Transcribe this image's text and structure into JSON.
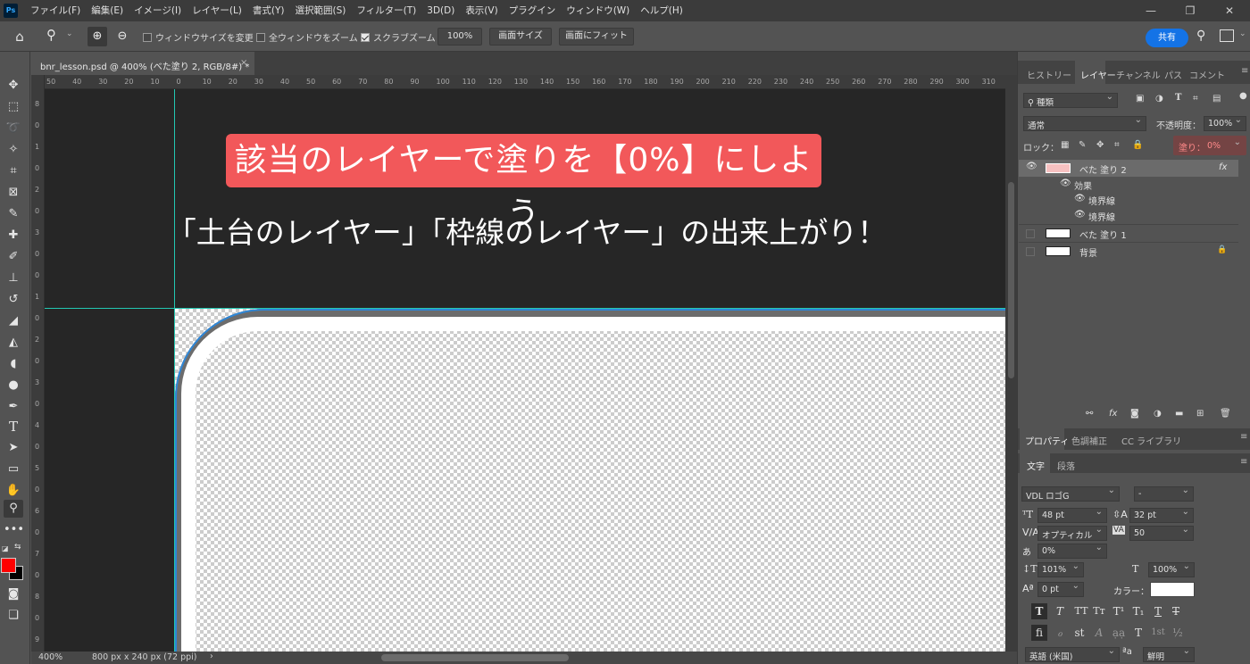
{
  "menubar": {
    "logo": "Ps",
    "items": [
      "ファイル(F)",
      "編集(E)",
      "イメージ(I)",
      "レイヤー(L)",
      "書式(Y)",
      "選択範囲(S)",
      "フィルター(T)",
      "3D(D)",
      "表示(V)",
      "プラグイン",
      "ウィンドウ(W)",
      "ヘルプ(H)"
    ]
  },
  "options": {
    "check1": "ウィンドウサイズを変更",
    "check2": "全ウィンドウをズーム",
    "check3": "スクラブズーム",
    "zoom_value": "100%",
    "fit_screen": "画面サイズ",
    "fill_screen": "画面にフィット",
    "share": "共有"
  },
  "document": {
    "tab_title": "bnr_lesson.psd @ 400% (べた塗り 2, RGB/8#) *",
    "ruler_top": [
      "50",
      "40",
      "30",
      "20",
      "10",
      "0",
      "10",
      "20",
      "30",
      "40",
      "50",
      "60",
      "70",
      "80",
      "90",
      "100",
      "110",
      "120",
      "130",
      "140",
      "150",
      "160",
      "170",
      "180",
      "190",
      "200",
      "210",
      "220",
      "230",
      "240",
      "250",
      "260",
      "270",
      "280",
      "290",
      "300",
      "310"
    ],
    "ruler_left": [
      "8",
      "0",
      "1",
      "0",
      "2",
      "0",
      "3",
      "0",
      "0",
      "1",
      "0",
      "2",
      "0",
      "3",
      "0",
      "4",
      "0",
      "5",
      "0",
      "6",
      "0",
      "7",
      "0",
      "8",
      "0",
      "9",
      "0"
    ],
    "banner_text": "該当のレイヤーで塗りを【0%】にしよう",
    "caption_text": "「土台のレイヤー」「枠線のレイヤー」の出来上がり！"
  },
  "status": {
    "zoom": "400%",
    "doc_size": "800 px x 240 px (72 ppi)",
    "arrow": "›"
  },
  "layers_panel": {
    "tabs": [
      "ヒストリー",
      "レイヤー",
      "チャンネル",
      "パス",
      "コメント"
    ],
    "filter_kind": "種類",
    "blend_mode": "通常",
    "opacity_label": "不透明度：",
    "opacity_value": "100%",
    "lock_label": "ロック：",
    "fill_label": "塗り：",
    "fill_value": "0%",
    "layers": [
      {
        "name": "べた 塗り 2",
        "fx": "fx",
        "visible": true,
        "selected": true
      },
      {
        "name": "効果",
        "sub": true
      },
      {
        "name": "境界線",
        "sub2": true
      },
      {
        "name": "境界線",
        "sub2": true
      },
      {
        "name": "べた 塗り 1",
        "visible": false
      },
      {
        "name": "背景",
        "visible": false,
        "locked": true
      }
    ]
  },
  "properties_panel": {
    "tabs": [
      "プロパティ",
      "色調補正",
      "CC ライブラリ"
    ],
    "subtabs": [
      "文字",
      "段落"
    ],
    "font_family": "VDL ロゴG",
    "font_style": "-",
    "font_size": "48 pt",
    "leading": "32 pt",
    "kerning": "オプティカル",
    "tracking": "50",
    "tsume": "0%",
    "vscale": "101%",
    "hscale": "100%",
    "baseline": "0 pt",
    "color_label": "カラー：",
    "color_value": "#ffffff",
    "language": "英語 (米国)",
    "antialias": "鮮明",
    "aa_label": "ªa"
  }
}
